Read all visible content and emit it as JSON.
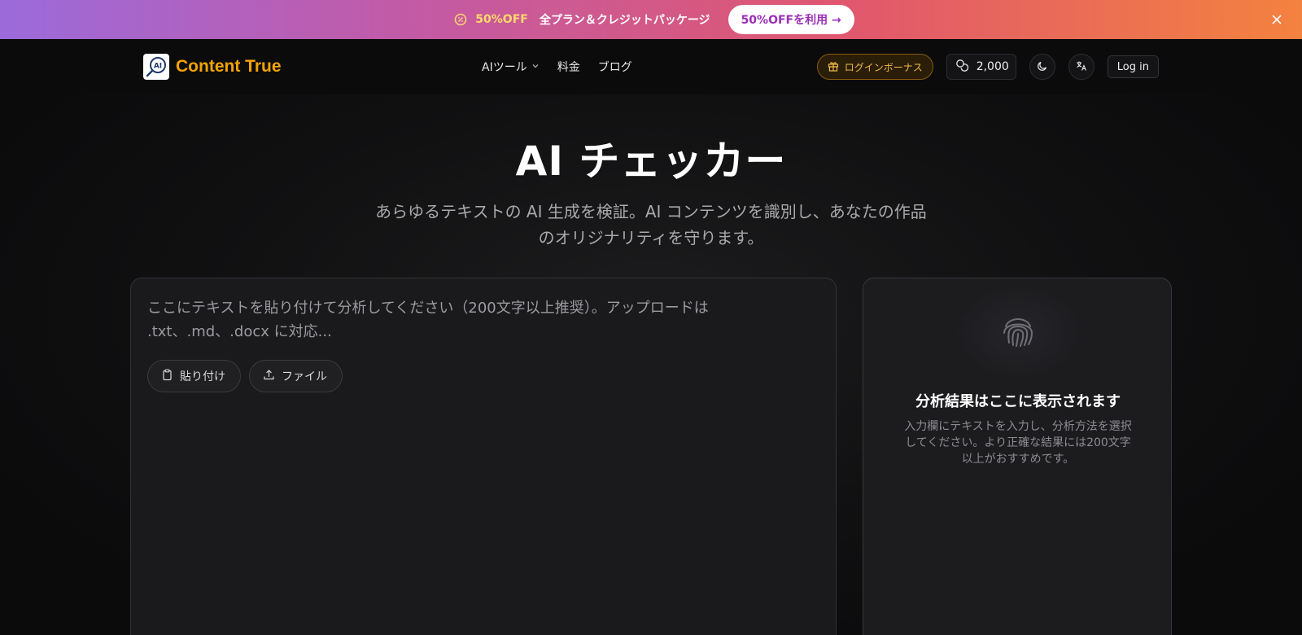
{
  "promo": {
    "off": "50%OFF",
    "text": "全プラン＆クレジットパッケージ",
    "cta": "50%OFFを利用 →"
  },
  "header": {
    "brand": "Content True",
    "logo_text": "AI",
    "nav": {
      "ai_tools": "AIツール",
      "pricing": "料金",
      "blog": "ブログ"
    },
    "bonus": "ログインボーナス",
    "credits": "2,000",
    "login": "Log in"
  },
  "hero": {
    "title": "AI チェッカー",
    "subtitle": "あらゆるテキストの AI 生成を検証。AI コンテンツを識別し、あなたの作品のオリジナリティを守ります。"
  },
  "input": {
    "placeholder": "ここにテキストを貼り付けて分析してください（200文字以上推奨）。アップロードは .txt、.md、.docx に対応...",
    "paste": "貼り付け",
    "file": "ファイル"
  },
  "result": {
    "title": "分析結果はここに表示されます",
    "description": "入力欄にテキストを入力し、分析方法を選択してください。より正確な結果には200文字以上がおすすめです。"
  },
  "colors": {
    "brand": "#f5a300",
    "promo_cta": "#9a2fb8",
    "bonus": "#f1b94a"
  },
  "icons": [
    "percent-badge-icon",
    "arrow-right-icon",
    "close-icon",
    "chevron-down-icon",
    "gift-icon",
    "coins-icon",
    "moon-icon",
    "translate-icon",
    "clipboard-icon",
    "upload-icon",
    "fingerprint-icon"
  ]
}
